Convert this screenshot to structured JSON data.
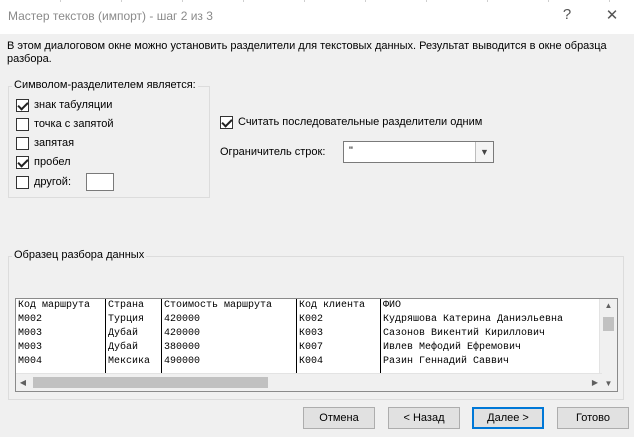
{
  "window": {
    "title": "Мастер текстов (импорт) - шаг 2 из 3",
    "help_label": "?",
    "close_label": "✕"
  },
  "description": "В этом диалоговом окне можно установить разделители для текстовых данных. Результат выводится в окне образца разбора.",
  "delimiters": {
    "title": "Символом-разделителем является:",
    "items": [
      {
        "label": "знак табуляции",
        "checked": true
      },
      {
        "label": "точка с запятой",
        "checked": false
      },
      {
        "label": "запятая",
        "checked": false
      },
      {
        "label": "пробел",
        "checked": true
      },
      {
        "label": "другой:",
        "checked": false
      }
    ],
    "other_value": ""
  },
  "consecutive": {
    "label": "Считать последовательные разделители одним",
    "checked": true
  },
  "qualifier": {
    "label": "Ограничитель строк:",
    "value": "\""
  },
  "preview": {
    "title": "Образец разбора данных",
    "columns": [
      "Код маршрута",
      "Страна",
      "Стоимость маршрута",
      "Код клиента",
      "ФИО"
    ],
    "rows": [
      [
        "Код маршрута",
        "Страна",
        "Стоимость маршрута",
        "Код клиента",
        "ФИО"
      ],
      [
        "М002",
        "Турция",
        "420000",
        "К002",
        "Кудряшова  Катерина Даниэльевна"
      ],
      [
        "М003",
        "Дубай",
        "420000",
        "К003",
        "Сазонов  Викентий Кириллович"
      ],
      [
        "М003",
        "Дубай",
        "380000",
        "К007",
        "Ивлев  Мефодий Ефремович"
      ],
      [
        "М004",
        "Мексика",
        "490000",
        "К004",
        "Разин  Геннадий Саввич"
      ]
    ]
  },
  "buttons": {
    "cancel": "Отмена",
    "back": "< Назад",
    "next": "Далее >",
    "finish": "Готово"
  },
  "icons": {
    "dropdown": "chevron-down-icon",
    "scroll_up": "▲",
    "scroll_down": "▼",
    "scroll_left": "◀",
    "scroll_right": "▶"
  }
}
